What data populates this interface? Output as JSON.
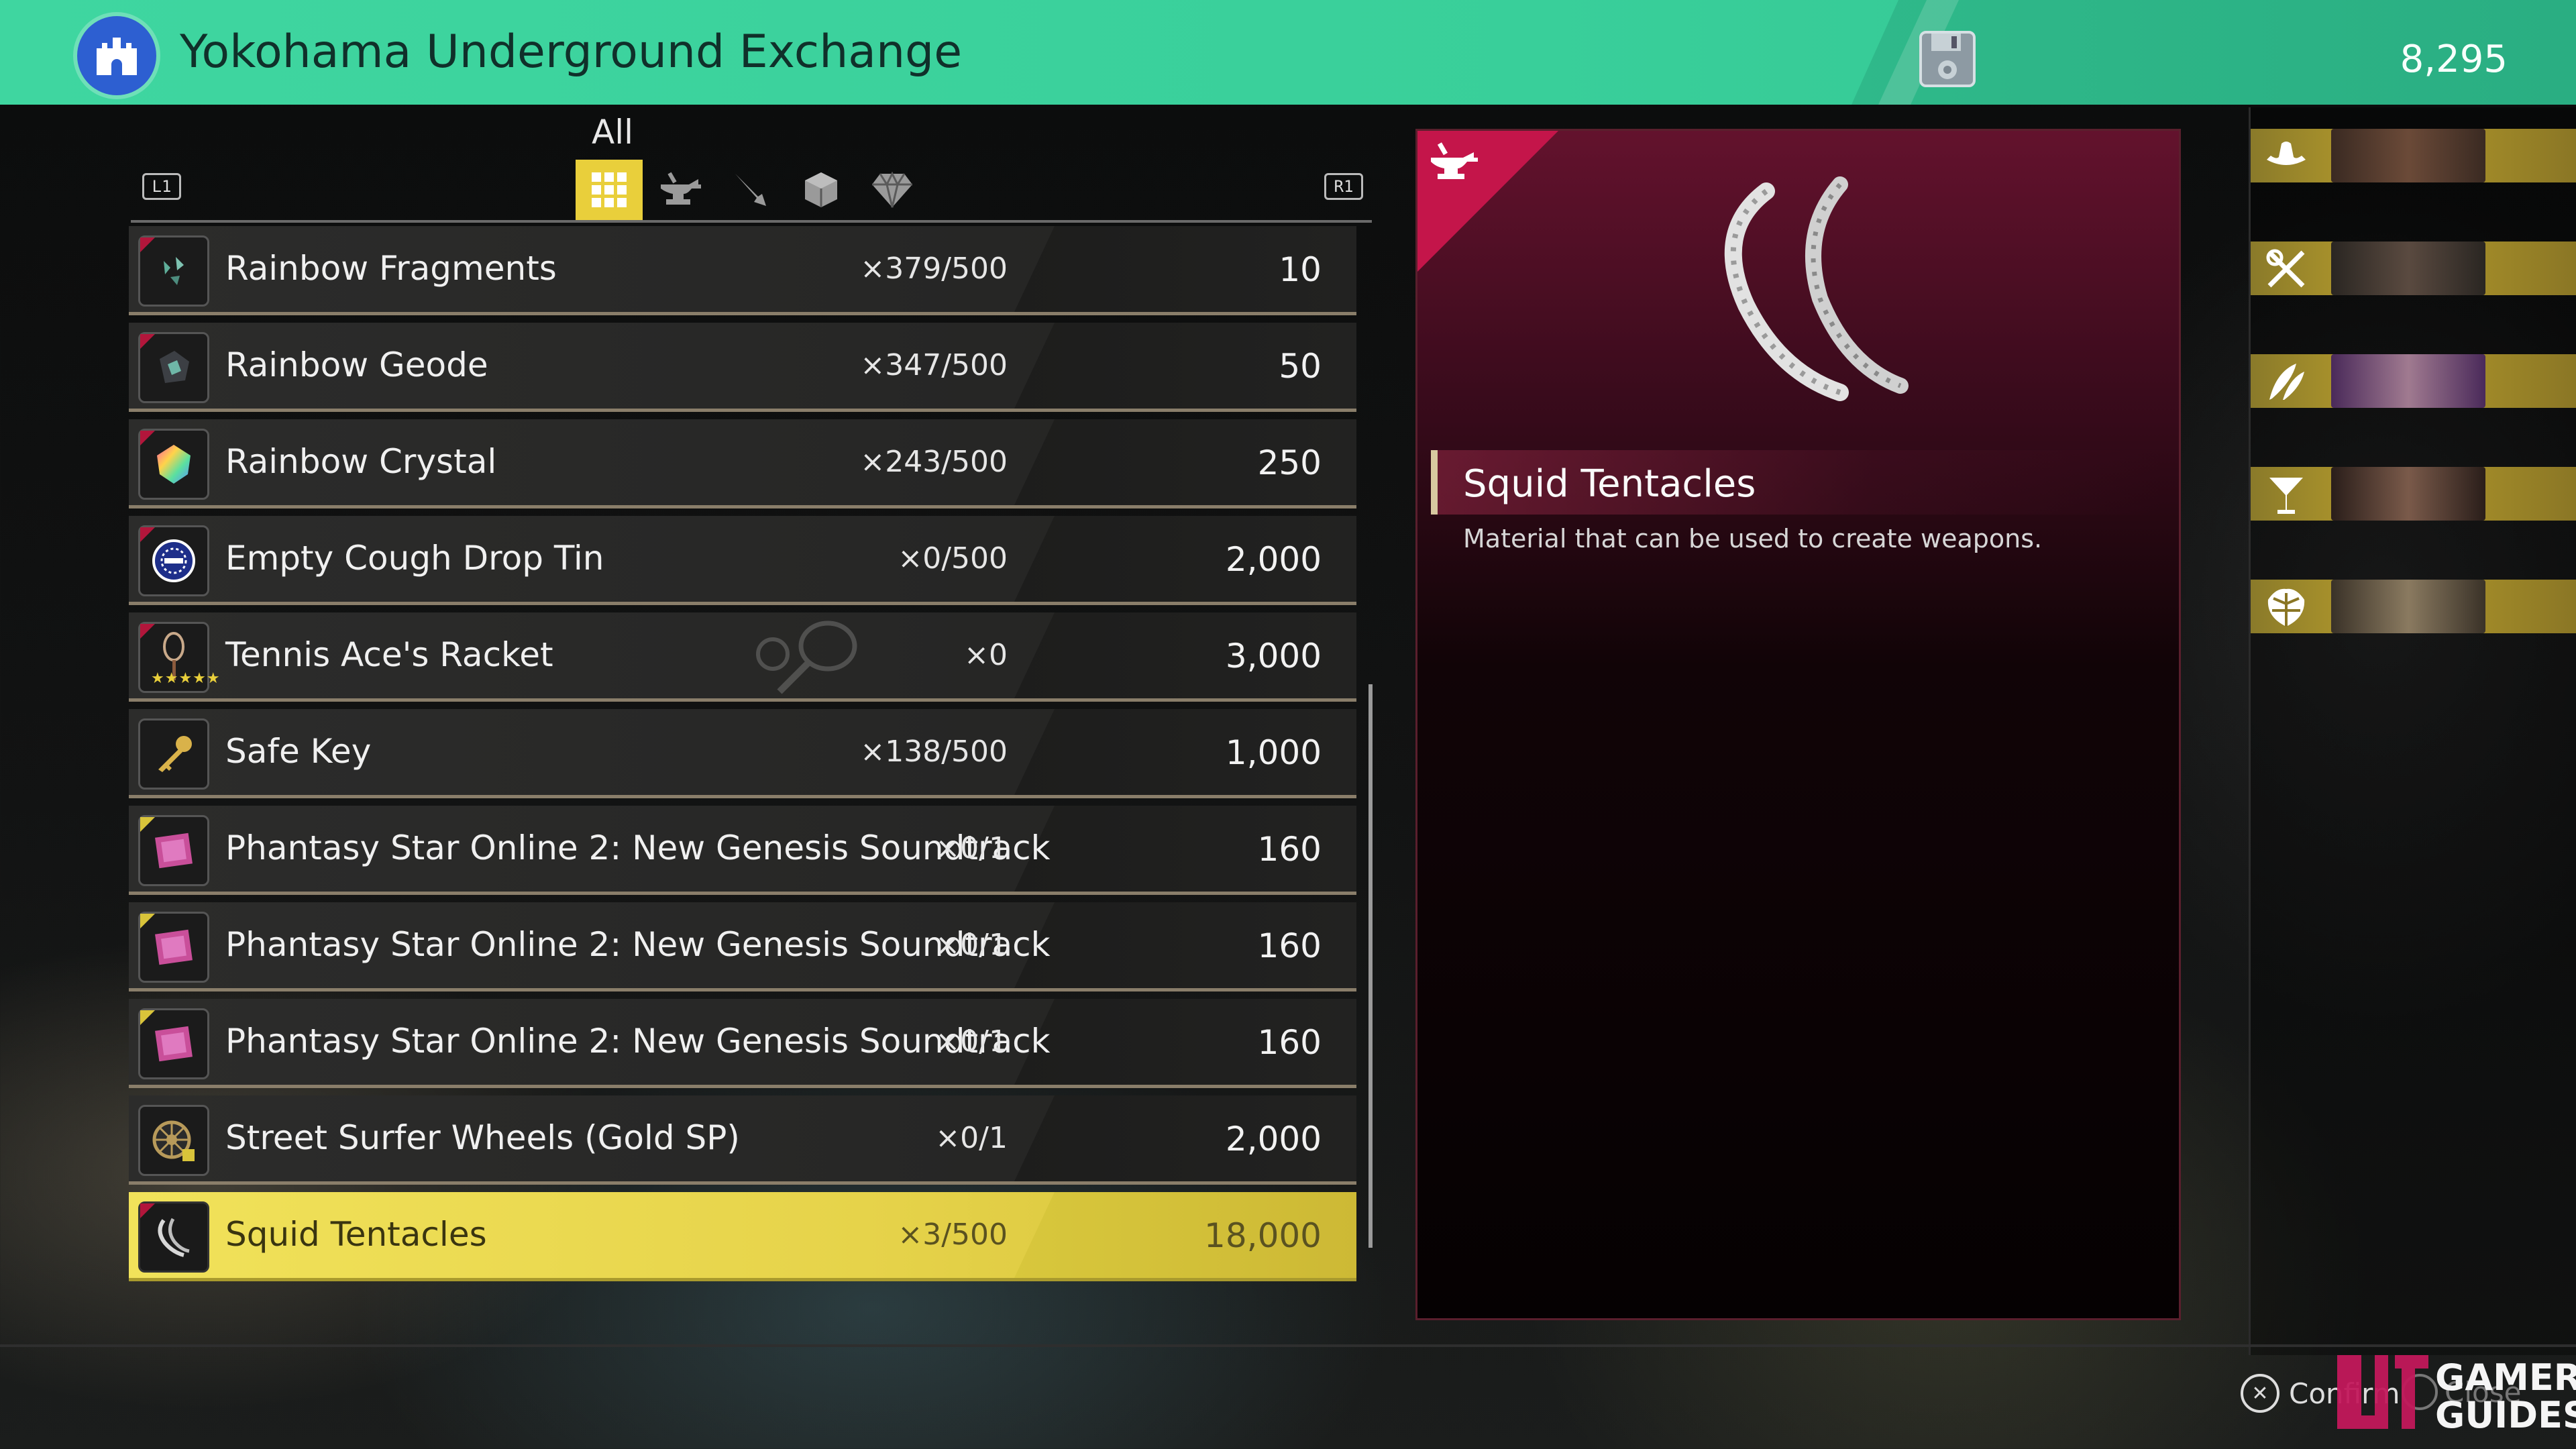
{
  "header": {
    "title": "Yokohama Underground Exchange",
    "money": "8,295",
    "icons": [
      "castle-icon",
      "save-icon"
    ]
  },
  "tabs": {
    "active_label": "All",
    "left_button": "L1",
    "right_button": "R1",
    "items": [
      "grid-all-icon",
      "anvil-icon",
      "knife-icon",
      "box-icon",
      "gem-icon"
    ]
  },
  "items": [
    {
      "name": "Rainbow Fragments",
      "qty": "×379/500",
      "price": "10"
    },
    {
      "name": "Rainbow Geode",
      "qty": "×347/500",
      "price": "50"
    },
    {
      "name": "Rainbow Crystal",
      "qty": "×243/500",
      "price": "250"
    },
    {
      "name": "Empty Cough Drop Tin",
      "qty": "×0/500",
      "price": "2,000"
    },
    {
      "name": "Tennis Ace's Racket",
      "qty": "×0",
      "price": "3,000",
      "stars": "★★★★★"
    },
    {
      "name": "Safe Key",
      "qty": "×138/500",
      "price": "1,000"
    },
    {
      "name": "Phantasy Star Online 2: New Genesis Soundtrack",
      "qty": "×0/1",
      "price": "160"
    },
    {
      "name": "Phantasy Star Online 2: New Genesis Soundtrack",
      "qty": "×0/1",
      "price": "160"
    },
    {
      "name": "Phantasy Star Online 2: New Genesis Soundtrack",
      "qty": "×0/1",
      "price": "160"
    },
    {
      "name": "Street Surfer Wheels (Gold SP)",
      "qty": "×0/1",
      "price": "2,000"
    },
    {
      "name": "Squid Tentacles",
      "qty": "×3/500",
      "price": "18,000",
      "selected": true
    }
  ],
  "detail": {
    "name": "Squid Tentacles",
    "description": "Material that can be used to create weapons."
  },
  "party": [
    "cowboy-hat-icon",
    "crossed-tools-icon",
    "feather-icon",
    "cocktail-icon",
    "monstera-leaf-icon"
  ],
  "footer": {
    "confirm_label": "Confirm",
    "close_label": "Close",
    "watermark_line1": "GAMER",
    "watermark_line2": "GUIDES"
  },
  "colors": {
    "header": "#3fd6a0",
    "selected_row": "#e6d34a",
    "detail_accent": "#c4154a",
    "rail_bar": "#b79d2c"
  }
}
